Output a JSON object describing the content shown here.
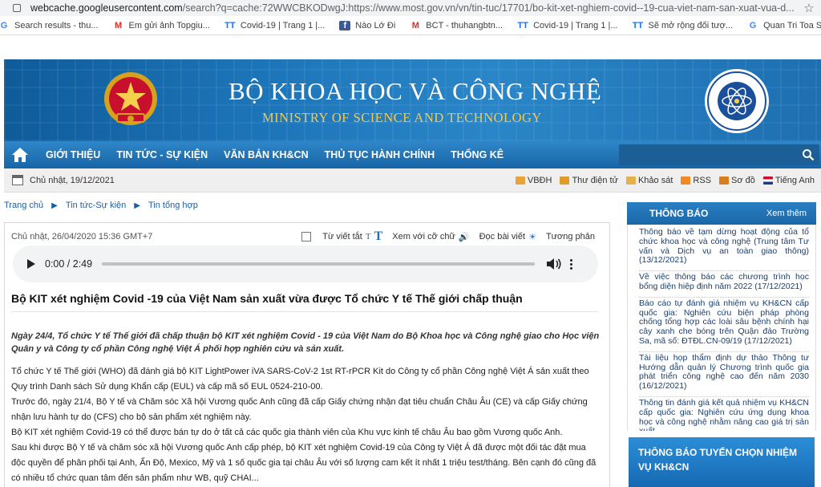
{
  "browser": {
    "url_host": "webcache.googleusercontent.com",
    "url_path": "/search?q=cache:72WWCBKODwgJ:https://www.most.gov.vn/vn/tin-tuc/17701/bo-kit-xet-nghiem-covid--19-cua-viet-nam-san-xuat-vua-d...",
    "bookmarks": [
      {
        "icon": "google-icon",
        "glyph": "G",
        "label": "Search results - thu..."
      },
      {
        "icon": "gmail-icon",
        "glyph": "M",
        "label": "Em gửi ảnh Topgiu..."
      },
      {
        "icon": "tt-icon",
        "glyph": "TT",
        "label": "Covid-19 | Trang 1 |..."
      },
      {
        "icon": "facebook-icon",
        "glyph": "f",
        "label": "Nào Lớ Đi"
      },
      {
        "icon": "gmail-icon",
        "glyph": "M",
        "label": "BCT - thuhangbtn..."
      },
      {
        "icon": "tt-icon",
        "glyph": "TT",
        "label": "Covid-19 | Trang 1 |..."
      },
      {
        "icon": "tt-icon",
        "glyph": "TT",
        "label": "Sẽ mở rộng đối tượ..."
      },
      {
        "icon": "google-icon",
        "glyph": "G",
        "label": "Quan Tri Toa Soan -..."
      }
    ]
  },
  "header": {
    "title_vn": "BỘ KHOA HỌC VÀ CÔNG NGHỆ",
    "title_en": "MINISTRY OF SCIENCE AND TECHNOLOGY",
    "colors": {
      "banner": "#1c74b8",
      "title_en": "#f6c94a",
      "nav": "#1f6fb0"
    }
  },
  "nav": {
    "items": [
      "GIỚI THIỆU",
      "TIN TỨC - SỰ KIỆN",
      "VĂN BẢN KH&CN",
      "THỦ TỤC HÀNH CHÍNH",
      "THỐNG KÊ"
    ]
  },
  "datebar": {
    "date": "Chủ nhật, 19/12/2021",
    "tools": [
      "VBĐH",
      "Thư điện tử",
      "Khảo sát",
      "RSS",
      "Sơ đồ",
      "Tiếng Anh"
    ]
  },
  "breadcrumb": [
    "Trang chủ",
    "Tin tức-Sự kiện",
    "Tin tổng hợp"
  ],
  "article": {
    "meta": "Chủ nhật, 26/04/2020 15:36 GMT+7",
    "tools": {
      "text_size": "Từ viết tắt",
      "font": "Xem với cỡ chữ",
      "read": "Đọc bài viết",
      "contrast": "Tương phản"
    },
    "audio": {
      "time": "0:00 / 2:49",
      "progress": 0
    },
    "headline": "Bộ KIT xét nghiệm Covid -19 của Việt Nam sản xuất vừa được Tổ chức Y tế Thế giới chấp thuận",
    "lead": "Ngày 24/4, Tổ chức Y tế Thế giới đã chấp thuận bộ KIT xét nghiệm Covid - 19 của Việt Nam do Bộ Khoa học và Công nghệ giao cho Học viện Quân y và Công ty cổ phần Công nghệ Việt Á phối hợp nghiên cứu và sản xuất.",
    "paragraphs": [
      "Tổ chức Y tế Thế giới (WHO) đã đánh giá bộ KIT LightPower iVA SARS-CoV-2 1st RT-rPCR Kit do Công ty cổ phần Công nghệ Việt Á sản xuất theo Quy trình Danh sách Sử dụng Khẩn cấp (EUL) và cấp mã số EUL 0524-210-00.",
      "Trước đó, ngày 21/4, Bộ Y tế và Chăm sóc Xã hội Vương quốc Anh cũng đã cấp Giấy chứng nhận đạt tiêu chuẩn Châu Âu (CE) và cấp Giấy chứng nhận lưu hành tự do (CFS) cho bộ sản phẩm xét nghiệm này.",
      "Bộ KIT xét nghiệm Covid-19 có thể được bán tự do ở tất cả các quốc gia thành viên của Khu vực kinh tế châu Âu bao gồm Vương quốc Anh.",
      "Sau khi được Bộ Y tế và chăm sóc xã hội Vương quốc Anh cấp phép, bộ KIT xét nghiệm Covid-19 của Công ty Việt Á đã được một đối tác đặt mua độc quyền để phân phối tại Anh, Ấn Độ, Mexico, Mỹ và 1 số quốc gia tại châu Âu với số lượng cam kết ít nhất 1 triệu test/tháng. Bên cạnh đó cũng đã có nhiều tổ chức quan tâm đến sản phẩm như WB, quỹ CHAI..."
    ]
  },
  "sidebar": {
    "heading": "THÔNG BÁO",
    "more": "Xem thêm",
    "items": [
      "Thông báo về tạm dừng hoạt động của tổ chức khoa học và công nghệ (Trung tâm Tư vấn và Dịch vụ an toàn giao thông) (13/12/2021)",
      "Về việc thông báo các chương trình học bổng diện hiệp định năm 2022 (17/12/2021)",
      "Báo cáo tự đánh giá nhiệm vụ KH&CN cấp quốc gia: Nghiên cứu biện pháp phòng chống tổng hợp các loài sâu bệnh chính hại cây xanh che bóng trên Quận đảo Trường Sa, mã số: ĐTĐL.CN-09/19 (17/12/2021)",
      "Tài liệu họp thẩm định dự thảo Thông tư Hướng dẫn quản lý Chương trình quốc gia phát triển công nghệ cao đến năm 2030 (16/12/2021)",
      "Thông tin đánh giá kết quả nhiệm vụ KH&CN cấp quốc gia: Nghiên cứu ứng dụng khoa học và công nghệ nhằm nâng cao giá trị sản xuất"
    ],
    "banner": "THÔNG BÁO TUYỂN CHỌN NHIỆM VỤ KH&CN"
  }
}
